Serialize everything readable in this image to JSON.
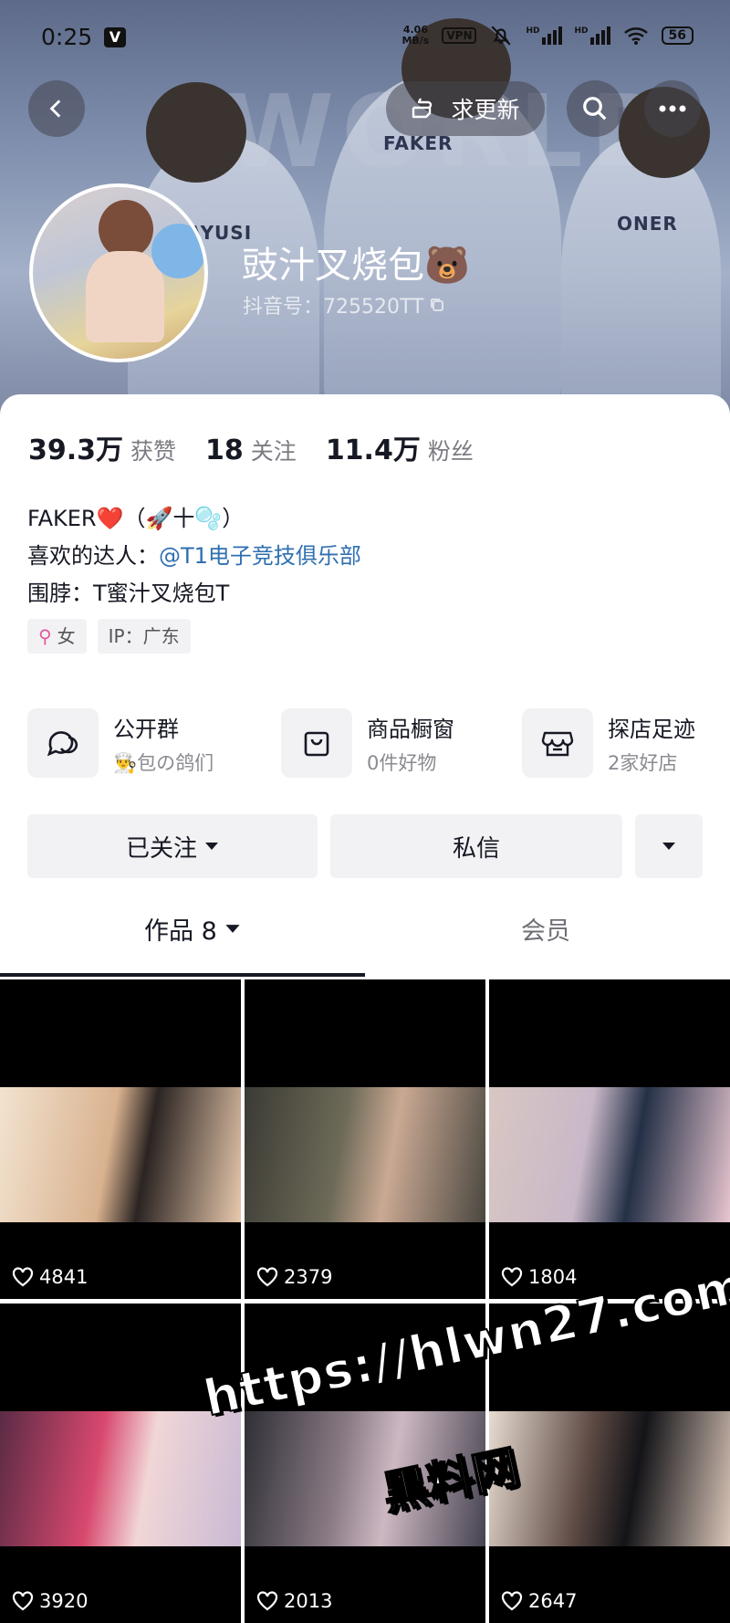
{
  "status_bar": {
    "time": "0:25",
    "badge": "V",
    "net_speed_top": "4.06",
    "net_speed_unit": "MB/s",
    "vpn": "VPN",
    "signal1": "HD",
    "signal2": "HD",
    "battery": "56"
  },
  "header": {
    "update_label": "求更新",
    "jersey_left": "AYUSI",
    "jersey_center": "FAKER",
    "jersey_right": "ONER",
    "brand": "WORLD"
  },
  "profile": {
    "nickname": "豉汁叉烧包🐻",
    "douyin_id": "抖音号：725520TT"
  },
  "stats": [
    {
      "num": "39.3万",
      "label": "获赞"
    },
    {
      "num": "18",
      "label": "关注"
    },
    {
      "num": "11.4万",
      "label": "粉丝"
    }
  ],
  "bio": {
    "line1": "FAKER❤️（🚀十🫧）",
    "line2_prefix": "喜欢的达人：",
    "line2_link": "@T1电子竞技俱乐部",
    "line3": "围脖：T蜜汁叉烧包T"
  },
  "tags": {
    "gender_icon": "⚲",
    "gender": "女",
    "ip": "IP：广东"
  },
  "shortcuts": [
    {
      "title": "公开群",
      "sub": "👨‍🍳包の鸽们",
      "icon": "chat-icon"
    },
    {
      "title": "商品橱窗",
      "sub": "0件好物",
      "icon": "bag-icon"
    },
    {
      "title": "探店足迹",
      "sub": "2家好店",
      "icon": "shop-icon"
    }
  ],
  "buttons": {
    "following": "已关注",
    "message": "私信"
  },
  "tabs": {
    "works": "作品 8",
    "member": "会员"
  },
  "videos": [
    {
      "likes": "4841"
    },
    {
      "likes": "2379"
    },
    {
      "likes": "1804"
    },
    {
      "likes": "3920"
    },
    {
      "likes": "2013"
    },
    {
      "likes": "2647"
    }
  ],
  "watermark": {
    "line1": "https://hlwn27.com",
    "line2": "黑料网"
  },
  "colors": {
    "link": "#2f6fb0",
    "female": "#e3599b",
    "button_bg": "#f2f2f4"
  }
}
